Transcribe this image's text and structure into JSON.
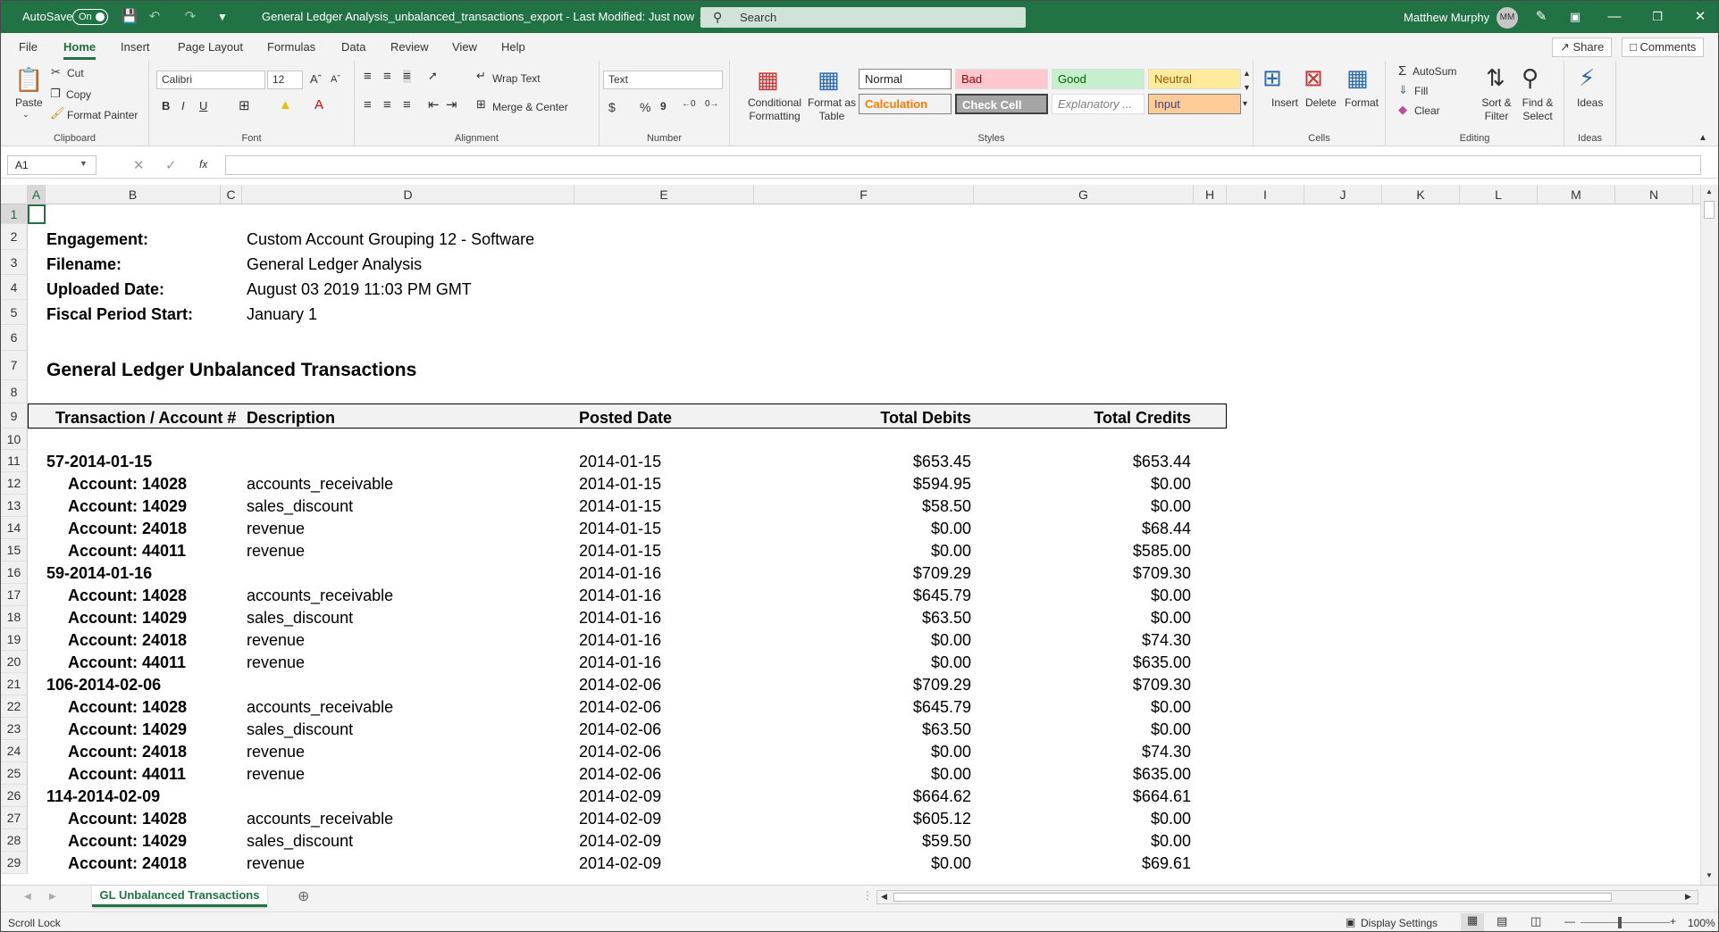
{
  "titlebar": {
    "autosave_label": "AutoSave",
    "autosave_state": "On",
    "title": "General Ledger Analysis_unbalanced_transactions_export  -  Last Modified: Just now ⌄",
    "search_placeholder": "Search",
    "user_name": "Matthew Murphy",
    "user_initials": "MM",
    "icons": [
      "save-icon",
      "undo-icon",
      "redo-icon",
      "customize-icon",
      "pen-icon",
      "ribbon-display-icon",
      "minimize-icon",
      "restore-icon",
      "close-icon"
    ]
  },
  "menu_tabs": [
    "File",
    "Home",
    "Insert",
    "Page Layout",
    "Formulas",
    "Data",
    "Review",
    "View",
    "Help"
  ],
  "active_tab": "Home",
  "share_label": "Share",
  "comments_label": "Comments",
  "ribbon": {
    "clipboard": {
      "paste": "Paste",
      "cut": "Cut",
      "copy": "Copy",
      "format_painter": "Format Painter",
      "label": "Clipboard"
    },
    "font": {
      "family": "Calibri",
      "size": "12",
      "label": "Font",
      "bold": "B",
      "italic": "I",
      "underline": "U"
    },
    "alignment": {
      "wrap": "Wrap Text",
      "merge": "Merge & Center",
      "label": "Alignment"
    },
    "number": {
      "format": "Text",
      "label": "Number",
      "currency": "$",
      "percent": "%",
      "comma": "9"
    },
    "conditional": "Conditional Formatting",
    "format_table": "Format as Table",
    "styles": {
      "label": "Styles",
      "normal": "Normal",
      "bad": "Bad",
      "good": "Good",
      "neutral": "Neutral",
      "calculation": "Calculation",
      "check_cell": "Check Cell",
      "explanatory": "Explanatory ...",
      "input": "Input"
    },
    "cells": {
      "insert": "Insert",
      "delete": "Delete",
      "format": "Format",
      "label": "Cells"
    },
    "editing": {
      "autosum": "AutoSum",
      "fill": "Fill",
      "clear": "Clear",
      "sort": "Sort & Filter",
      "find": "Find & Select",
      "label": "Editing"
    },
    "ideas": {
      "ideas": "Ideas",
      "label": "Ideas"
    }
  },
  "formula_bar": {
    "name_box": "A1",
    "fx": "fx",
    "value": ""
  },
  "columns": [
    "A",
    "B",
    "C",
    "D",
    "E",
    "F",
    "G",
    "H",
    "I",
    "J",
    "K",
    "L",
    "M",
    "N"
  ],
  "row_numbers": [
    "1",
    "2",
    "3",
    "4",
    "5",
    "6",
    "7",
    "8",
    "9",
    "10",
    "11",
    "12",
    "13",
    "14",
    "15",
    "16",
    "17",
    "18",
    "19",
    "20",
    "21",
    "22",
    "23",
    "24",
    "25",
    "26",
    "27",
    "28",
    "29"
  ],
  "meta": [
    {
      "label": "Engagement:",
      "value": "Custom Account Grouping 12 - Software"
    },
    {
      "label": "Filename:",
      "value": "General Ledger Analysis"
    },
    {
      "label": "Uploaded Date:",
      "value": "August 03 2019 11:03 PM GMT"
    },
    {
      "label": "Fiscal Period Start:",
      "value": "January 1"
    }
  ],
  "report_title": "General Ledger Unbalanced Transactions",
  "headers": {
    "account": "Transaction / Account #",
    "description": "Description",
    "posted": "Posted Date",
    "debits": "Total Debits",
    "credits": "Total Credits"
  },
  "rows": [
    {
      "account": "57-2014-01-15",
      "description": "",
      "posted": "2014-01-15",
      "debits": "$653.45",
      "credits": "$653.44",
      "group": true
    },
    {
      "account": "Account: 14028",
      "description": "accounts_receivable",
      "posted": "2014-01-15",
      "debits": "$594.95",
      "credits": "$0.00"
    },
    {
      "account": "Account: 14029",
      "description": "sales_discount",
      "posted": "2014-01-15",
      "debits": "$58.50",
      "credits": "$0.00"
    },
    {
      "account": "Account: 24018",
      "description": "revenue",
      "posted": "2014-01-15",
      "debits": "$0.00",
      "credits": "$68.44"
    },
    {
      "account": "Account: 44011",
      "description": "revenue",
      "posted": "2014-01-15",
      "debits": "$0.00",
      "credits": "$585.00"
    },
    {
      "account": "59-2014-01-16",
      "description": "",
      "posted": "2014-01-16",
      "debits": "$709.29",
      "credits": "$709.30",
      "group": true
    },
    {
      "account": "Account: 14028",
      "description": "accounts_receivable",
      "posted": "2014-01-16",
      "debits": "$645.79",
      "credits": "$0.00"
    },
    {
      "account": "Account: 14029",
      "description": "sales_discount",
      "posted": "2014-01-16",
      "debits": "$63.50",
      "credits": "$0.00"
    },
    {
      "account": "Account: 24018",
      "description": "revenue",
      "posted": "2014-01-16",
      "debits": "$0.00",
      "credits": "$74.30"
    },
    {
      "account": "Account: 44011",
      "description": "revenue",
      "posted": "2014-01-16",
      "debits": "$0.00",
      "credits": "$635.00"
    },
    {
      "account": "106-2014-02-06",
      "description": "",
      "posted": "2014-02-06",
      "debits": "$709.29",
      "credits": "$709.30",
      "group": true
    },
    {
      "account": "Account: 14028",
      "description": "accounts_receivable",
      "posted": "2014-02-06",
      "debits": "$645.79",
      "credits": "$0.00"
    },
    {
      "account": "Account: 14029",
      "description": "sales_discount",
      "posted": "2014-02-06",
      "debits": "$63.50",
      "credits": "$0.00"
    },
    {
      "account": "Account: 24018",
      "description": "revenue",
      "posted": "2014-02-06",
      "debits": "$0.00",
      "credits": "$74.30"
    },
    {
      "account": "Account: 44011",
      "description": "revenue",
      "posted": "2014-02-06",
      "debits": "$0.00",
      "credits": "$635.00"
    },
    {
      "account": "114-2014-02-09",
      "description": "",
      "posted": "2014-02-09",
      "debits": "$664.62",
      "credits": "$664.61",
      "group": true
    },
    {
      "account": "Account: 14028",
      "description": "accounts_receivable",
      "posted": "2014-02-09",
      "debits": "$605.12",
      "credits": "$0.00"
    },
    {
      "account": "Account: 14029",
      "description": "sales_discount",
      "posted": "2014-02-09",
      "debits": "$59.50",
      "credits": "$0.00"
    },
    {
      "account": "Account: 24018",
      "description": "revenue",
      "posted": "2014-02-09",
      "debits": "$0.00",
      "credits": "$69.61"
    }
  ],
  "sheet_tab": "GL Unbalanced Transactions",
  "status": {
    "left": "Scroll Lock",
    "display_settings": "Display Settings",
    "zoom": "100%"
  }
}
